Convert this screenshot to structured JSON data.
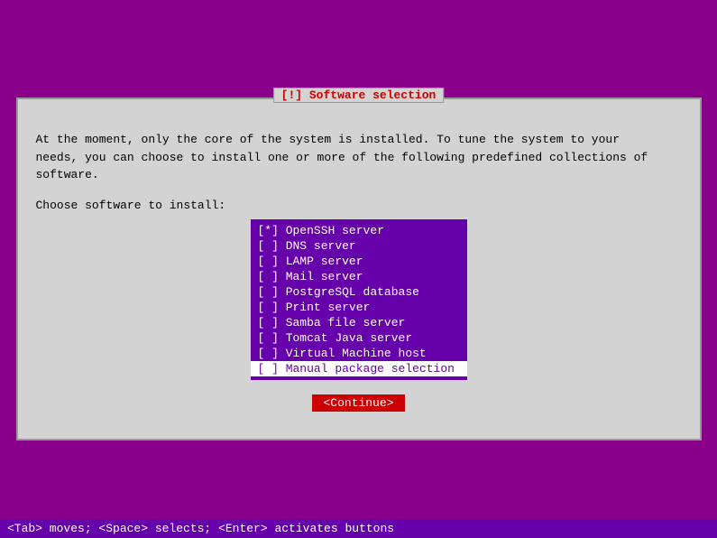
{
  "title": "[!] Software selection",
  "description_line1": "At the moment, only the core of the system is installed. To tune the system to your",
  "description_line2": "needs, you can choose to install one or more of the following predefined collections of",
  "description_line3": "software.",
  "choose_label": "Choose software to install:",
  "software_items": [
    {
      "id": "openssh",
      "checked": true,
      "label": "OpenSSH server",
      "highlighted": false
    },
    {
      "id": "dns",
      "checked": false,
      "label": "DNS server",
      "highlighted": false
    },
    {
      "id": "lamp",
      "checked": false,
      "label": "LAMP server",
      "highlighted": false
    },
    {
      "id": "mail",
      "checked": false,
      "label": "Mail server",
      "highlighted": false
    },
    {
      "id": "postgresql",
      "checked": false,
      "label": "PostgreSQL database",
      "highlighted": false
    },
    {
      "id": "print",
      "checked": false,
      "label": "Print server",
      "highlighted": false
    },
    {
      "id": "samba",
      "checked": false,
      "label": "Samba file server",
      "highlighted": false
    },
    {
      "id": "tomcat",
      "checked": false,
      "label": "Tomcat Java server",
      "highlighted": false
    },
    {
      "id": "vm",
      "checked": false,
      "label": "Virtual Machine host",
      "highlighted": false
    },
    {
      "id": "manual",
      "checked": false,
      "label": "Manual package selection",
      "highlighted": true
    }
  ],
  "continue_button_label": "<Continue>",
  "status_bar": "<Tab> moves; <Space> selects; <Enter> activates buttons"
}
